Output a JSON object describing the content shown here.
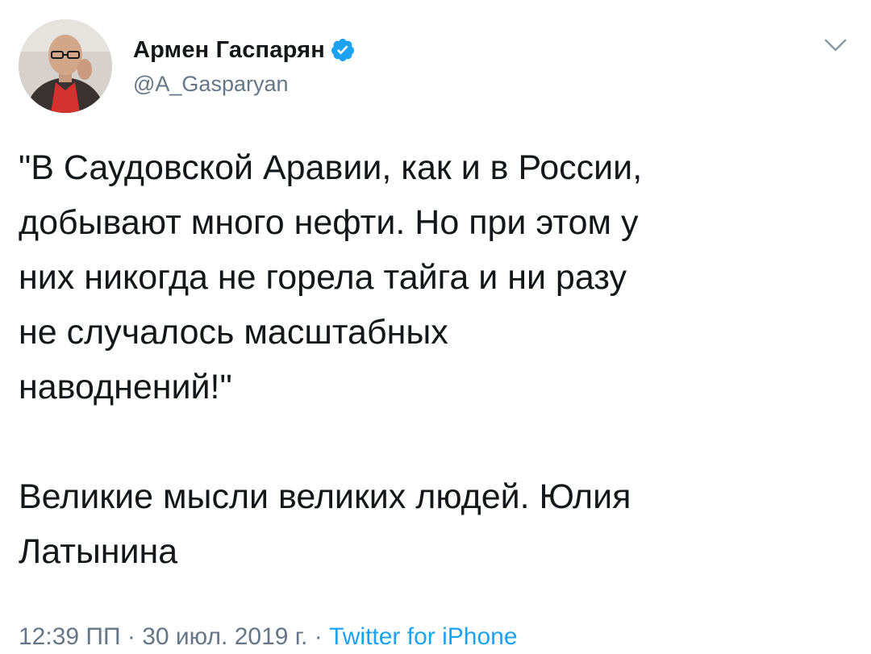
{
  "tweet": {
    "author": {
      "display_name": "Армен Гаспарян",
      "handle": "@A_Gasparyan",
      "verified": true,
      "avatar_icon": "profile-photo"
    },
    "menu_icon": "chevron-down-icon",
    "text": "\"В Саудовской Аравии, как и в России,\nдобывают много нефти. Но при этом у\nних никогда не горела тайга и ни разу\nне случалось масштабных\nнаводнений!\"\n\nВеликие мысли великих людей. Юлия\nЛатынина",
    "time": "12:39 ПП",
    "separator": " · ",
    "date": "30 июл. 2019 г.",
    "source": "Twitter for iPhone"
  },
  "colors": {
    "text": "#14171a",
    "secondary": "#657786",
    "accent": "#1da1f2"
  }
}
